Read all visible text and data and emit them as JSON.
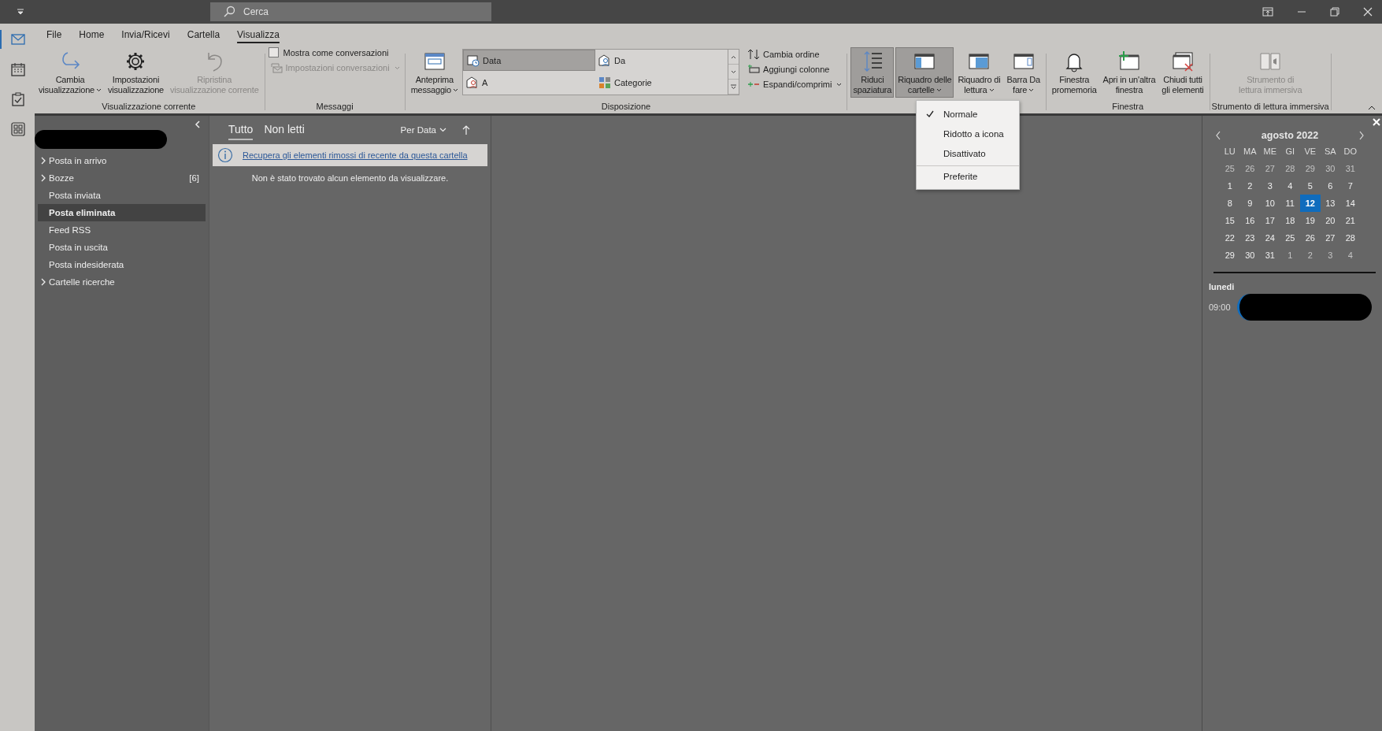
{
  "title_bar": {
    "search_placeholder": "Cerca"
  },
  "nav_rail": [
    {
      "kind": "mail",
      "selected": true
    },
    {
      "kind": "calendar",
      "selected": false
    },
    {
      "kind": "tasks",
      "selected": false
    },
    {
      "kind": "apps",
      "selected": false
    }
  ],
  "ribbon": {
    "tabs": [
      {
        "label": "File",
        "selected": false
      },
      {
        "label": "Home",
        "selected": false
      },
      {
        "label": "Invia/Ricevi",
        "selected": false
      },
      {
        "label": "Cartella",
        "selected": false
      },
      {
        "label": "Visualizza",
        "selected": true
      }
    ],
    "view_group": {
      "label": "Visualizzazione corrente",
      "buttons": [
        {
          "lines": [
            "Cambia",
            "visualizzazione"
          ],
          "dropdown": true,
          "disabled": false
        },
        {
          "lines": [
            "Impostazioni",
            "visualizzazione"
          ],
          "dropdown": false,
          "disabled": false
        },
        {
          "lines": [
            "Ripristina",
            "visualizzazione corrente"
          ],
          "dropdown": false,
          "disabled": true
        }
      ]
    },
    "messages_group": {
      "label": "Messaggi",
      "checkbox": {
        "label": "Mostra come conversazioni",
        "checked": false
      },
      "settings": {
        "label": "Impostazioni conversazioni",
        "dropdown": true,
        "disabled": true
      }
    },
    "arrangement_group": {
      "label": "Disposizione",
      "preview": {
        "lines": [
          "Anteprima",
          "messaggio"
        ],
        "dropdown": true
      },
      "gallery": [
        {
          "label": "Data",
          "selected": true
        },
        {
          "label": "Da",
          "selected": false
        },
        {
          "label": "A",
          "selected": false
        },
        {
          "label": "Categorie",
          "selected": false
        }
      ],
      "commands": [
        {
          "label": "Cambia ordine",
          "dropdown": false
        },
        {
          "label": "Aggiungi colonne",
          "dropdown": false
        },
        {
          "label": "Espandi/comprimi",
          "dropdown": true
        }
      ]
    },
    "layout_group": {
      "buttons": [
        {
          "lines": [
            "Riduci",
            "spaziatura"
          ],
          "dropdown": false,
          "pressed": true
        },
        {
          "lines": [
            "Riquadro delle",
            "cartelle"
          ],
          "dropdown": true,
          "pressed": true
        },
        {
          "lines": [
            "Riquadro di",
            "lettura"
          ],
          "dropdown": true,
          "pressed": false
        },
        {
          "lines": [
            "Barra Da",
            "fare"
          ],
          "dropdown": true,
          "pressed": false
        }
      ]
    },
    "window_group": {
      "label": "Finestra",
      "buttons": [
        {
          "lines": [
            "Finestra",
            "promemoria"
          ]
        },
        {
          "lines": [
            "Apri in un'altra",
            "finestra"
          ]
        },
        {
          "lines": [
            "Chiudi tutti",
            "gli elementi"
          ]
        }
      ]
    },
    "reader_group": {
      "label": "Strumento di lettura immersiva",
      "button": {
        "lines": [
          "Strumento di",
          "lettura immersiva"
        ],
        "disabled": true
      }
    }
  },
  "folder_pane_menu": [
    {
      "label": "Normale",
      "checked": true,
      "separator_before": false
    },
    {
      "label": "Ridotto a icona",
      "checked": false,
      "separator_before": false
    },
    {
      "label": "Disattivato",
      "checked": false,
      "separator_before": false
    },
    {
      "label": "Preferite",
      "checked": false,
      "separator_before": true
    }
  ],
  "folders": [
    {
      "label": "Posta in arrivo",
      "expandable": true,
      "selected": false
    },
    {
      "label": "Bozze",
      "expandable": true,
      "selected": false,
      "count": "[6]"
    },
    {
      "label": "Posta inviata",
      "expandable": false,
      "selected": false
    },
    {
      "label": "Posta eliminata",
      "expandable": false,
      "selected": true
    },
    {
      "label": "Feed RSS",
      "expandable": false,
      "selected": false
    },
    {
      "label": "Posta in uscita",
      "expandable": false,
      "selected": false
    },
    {
      "label": "Posta indesiderata",
      "expandable": false,
      "selected": false
    },
    {
      "label": "Cartelle ricerche",
      "expandable": true,
      "selected": false
    }
  ],
  "message_list": {
    "tabs": [
      {
        "label": "Tutto",
        "selected": true
      },
      {
        "label": "Non letti",
        "selected": false
      }
    ],
    "sort": "Per Data",
    "info_link": "Recupera gli elementi rimossi di recente da questa cartella",
    "empty_text": "Non è stato trovato alcun elemento da visualizzare."
  },
  "todo_bar": {
    "month": "agosto 2022",
    "weekdays": [
      "LU",
      "MA",
      "ME",
      "GI",
      "VE",
      "SA",
      "DO"
    ],
    "days": [
      {
        "label": "25",
        "other": true,
        "selected": false
      },
      {
        "label": "26",
        "other": true,
        "selected": false
      },
      {
        "label": "27",
        "other": true,
        "selected": false
      },
      {
        "label": "28",
        "other": true,
        "selected": false
      },
      {
        "label": "29",
        "other": true,
        "selected": false
      },
      {
        "label": "30",
        "other": true,
        "selected": false
      },
      {
        "label": "31",
        "other": true,
        "selected": false
      },
      {
        "label": "1",
        "other": false,
        "selected": false
      },
      {
        "label": "2",
        "other": false,
        "selected": false
      },
      {
        "label": "3",
        "other": false,
        "selected": false
      },
      {
        "label": "4",
        "other": false,
        "selected": false
      },
      {
        "label": "5",
        "other": false,
        "selected": false
      },
      {
        "label": "6",
        "other": false,
        "selected": false
      },
      {
        "label": "7",
        "other": false,
        "selected": false
      },
      {
        "label": "8",
        "other": false,
        "selected": false
      },
      {
        "label": "9",
        "other": false,
        "selected": false
      },
      {
        "label": "10",
        "other": false,
        "selected": false
      },
      {
        "label": "11",
        "other": false,
        "selected": false
      },
      {
        "label": "12",
        "other": false,
        "selected": true
      },
      {
        "label": "13",
        "other": false,
        "selected": false
      },
      {
        "label": "14",
        "other": false,
        "selected": false
      },
      {
        "label": "15",
        "other": false,
        "selected": false
      },
      {
        "label": "16",
        "other": false,
        "selected": false
      },
      {
        "label": "17",
        "other": false,
        "selected": false
      },
      {
        "label": "18",
        "other": false,
        "selected": false
      },
      {
        "label": "19",
        "other": false,
        "selected": false
      },
      {
        "label": "20",
        "other": false,
        "selected": false
      },
      {
        "label": "21",
        "other": false,
        "selected": false
      },
      {
        "label": "22",
        "other": false,
        "selected": false
      },
      {
        "label": "23",
        "other": false,
        "selected": false
      },
      {
        "label": "24",
        "other": false,
        "selected": false
      },
      {
        "label": "25",
        "other": false,
        "selected": false
      },
      {
        "label": "26",
        "other": false,
        "selected": false
      },
      {
        "label": "27",
        "other": false,
        "selected": false
      },
      {
        "label": "28",
        "other": false,
        "selected": false
      },
      {
        "label": "29",
        "other": false,
        "selected": false
      },
      {
        "label": "30",
        "other": false,
        "selected": false
      },
      {
        "label": "31",
        "other": false,
        "selected": false
      },
      {
        "label": "1",
        "other": true,
        "selected": false
      },
      {
        "label": "2",
        "other": true,
        "selected": false
      },
      {
        "label": "3",
        "other": true,
        "selected": false
      },
      {
        "label": "4",
        "other": true,
        "selected": false
      }
    ],
    "agenda_day": "lunedi",
    "agenda_time": "09:00"
  }
}
